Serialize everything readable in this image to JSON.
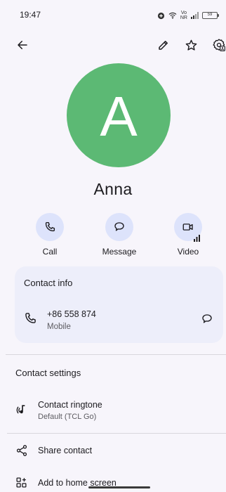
{
  "status_bar": {
    "time": "19:47",
    "network_top": "Vo",
    "network_bottom": "NR",
    "battery": "59"
  },
  "toolbar": {
    "back_icon": "arrow-left-icon",
    "edit_icon": "pencil-icon",
    "favorite_icon": "star-outline-icon",
    "settings_icon": "contact-settings-icon"
  },
  "contact": {
    "avatar_letter": "A",
    "avatar_color": "#5cb974",
    "name": "Anna"
  },
  "actions": [
    {
      "label": "Call",
      "icon": "phone-icon"
    },
    {
      "label": "Message",
      "icon": "message-bubble-icon"
    },
    {
      "label": "Video",
      "icon": "videocam-icon"
    }
  ],
  "contact_info": {
    "title": "Contact info",
    "phone": "+86 558 874",
    "phone_type": "Mobile"
  },
  "contact_settings": {
    "title": "Contact settings",
    "ringtone_label": "Contact ringtone",
    "ringtone_value": "Default (TCL Go)",
    "share_label": "Share contact",
    "home_label": "Add to home screen"
  },
  "colors": {
    "background": "#f7f5fb",
    "action_circle": "#dde3fb",
    "card": "#edeefa"
  }
}
